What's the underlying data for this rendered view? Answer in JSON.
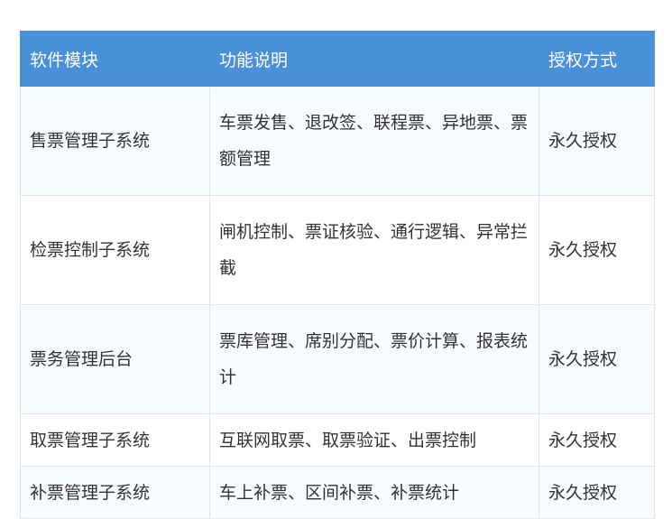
{
  "table": {
    "headers": [
      "软件模块",
      "功能说明",
      "授权方式"
    ],
    "rows": [
      {
        "module": "售票管理子系统",
        "description": "车票发售、退改签、联程票、异地票、票额管理",
        "license": "永久授权"
      },
      {
        "module": "检票控制子系统",
        "description": "闸机控制、票证核验、通行逻辑、异常拦截",
        "license": "永久授权"
      },
      {
        "module": "票务管理后台",
        "description": "票库管理、席别分配、票价计算、报表统计",
        "license": "永久授权"
      },
      {
        "module": "取票管理子系统",
        "description": "互联网取票、取票验证、出票控制",
        "license": "永久授权"
      },
      {
        "module": "补票管理子系统",
        "description": "车上补票、区间补票、补票统计",
        "license": "永久授权"
      }
    ]
  },
  "colors": {
    "header_bg": "#4a90d9",
    "header_text": "#ffffff",
    "row_alt_bg": "#f7fafe",
    "border": "#dde6ef",
    "text": "#333333"
  }
}
